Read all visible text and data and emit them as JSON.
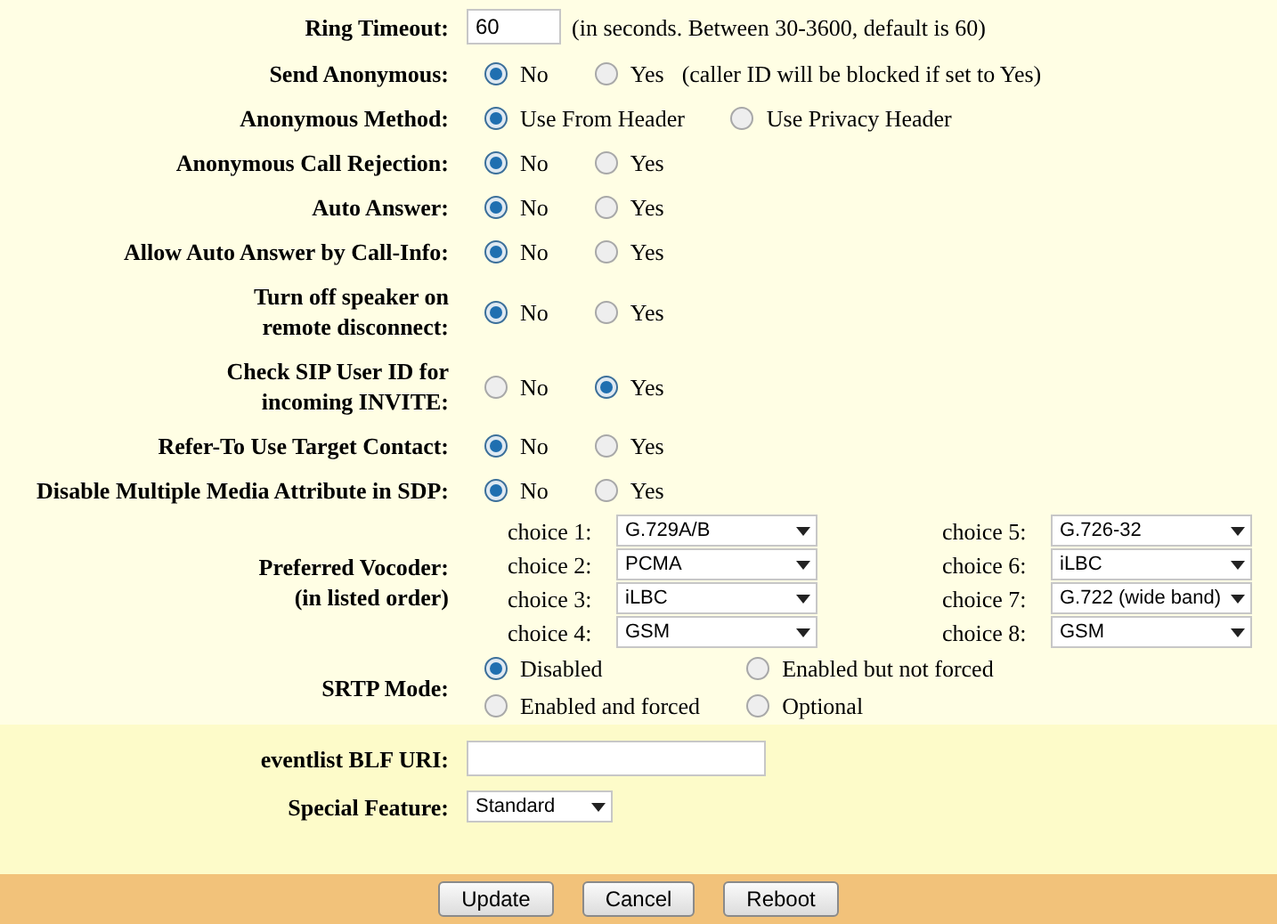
{
  "settings": [
    {
      "kind": "text",
      "label": [
        "Ring Timeout:"
      ],
      "value": "60",
      "note": "(in seconds. Between 30-3600, default is 60)"
    },
    {
      "kind": "radio",
      "label": [
        "Send Anonymous:"
      ],
      "options": [
        {
          "label": "No",
          "selected": true
        },
        {
          "label": "Yes",
          "selected": false
        }
      ],
      "note": "(caller ID will be blocked if set to Yes)"
    },
    {
      "kind": "radio",
      "label": [
        "Anonymous Method:"
      ],
      "options": [
        {
          "label": "Use From Header",
          "selected": true
        },
        {
          "label": "Use Privacy Header",
          "selected": false
        }
      ]
    },
    {
      "kind": "radio",
      "label": [
        "Anonymous Call Rejection:"
      ],
      "options": [
        {
          "label": "No",
          "selected": true
        },
        {
          "label": "Yes",
          "selected": false
        }
      ]
    },
    {
      "kind": "radio",
      "label": [
        "Auto Answer:"
      ],
      "options": [
        {
          "label": "No",
          "selected": true
        },
        {
          "label": "Yes",
          "selected": false
        }
      ]
    },
    {
      "kind": "radio",
      "label": [
        "Allow Auto Answer by Call-Info:"
      ],
      "options": [
        {
          "label": "No",
          "selected": true
        },
        {
          "label": "Yes",
          "selected": false
        }
      ]
    },
    {
      "kind": "radio",
      "label": [
        "Turn off speaker on",
        "remote disconnect:"
      ],
      "options": [
        {
          "label": "No",
          "selected": true
        },
        {
          "label": "Yes",
          "selected": false
        }
      ]
    },
    {
      "kind": "radio",
      "label": [
        "Check SIP User ID for",
        "incoming INVITE:"
      ],
      "options": [
        {
          "label": "No",
          "selected": false
        },
        {
          "label": "Yes",
          "selected": true
        }
      ]
    },
    {
      "kind": "radio",
      "label": [
        "Refer-To Use Target Contact:"
      ],
      "options": [
        {
          "label": "No",
          "selected": true
        },
        {
          "label": "Yes",
          "selected": false
        }
      ]
    },
    {
      "kind": "radio",
      "label": [
        "Disable Multiple Media Attribute in SDP:"
      ],
      "options": [
        {
          "label": "No",
          "selected": true
        },
        {
          "label": "Yes",
          "selected": false
        }
      ]
    },
    {
      "kind": "vocoder",
      "label": [
        "Preferred Vocoder:",
        "(in listed order)"
      ],
      "choices": [
        {
          "label": "choice 1:",
          "value": "G.729A/B"
        },
        {
          "label": "choice 2:",
          "value": "PCMA"
        },
        {
          "label": "choice 3:",
          "value": "iLBC"
        },
        {
          "label": "choice 4:",
          "value": "GSM"
        },
        {
          "label": "choice 5:",
          "value": "G.726-32"
        },
        {
          "label": "choice 6:",
          "value": "iLBC"
        },
        {
          "label": "choice 7:",
          "value": "G.722 (wide band)"
        },
        {
          "label": "choice 8:",
          "value": "GSM"
        }
      ]
    },
    {
      "kind": "radio-grid",
      "label": [
        "SRTP Mode:"
      ],
      "options": [
        {
          "label": "Disabled",
          "selected": true
        },
        {
          "label": "Enabled but not forced",
          "selected": false
        },
        {
          "label": "Enabled and forced",
          "selected": false
        },
        {
          "label": "Optional",
          "selected": false
        }
      ]
    }
  ],
  "extra": [
    {
      "kind": "text",
      "label": [
        "eventlist BLF URI:"
      ]
    },
    {
      "kind": "select",
      "label": [
        "Special Feature:"
      ],
      "value": "Standard"
    }
  ],
  "buttons": [
    "Update",
    "Cancel",
    "Reboot"
  ]
}
